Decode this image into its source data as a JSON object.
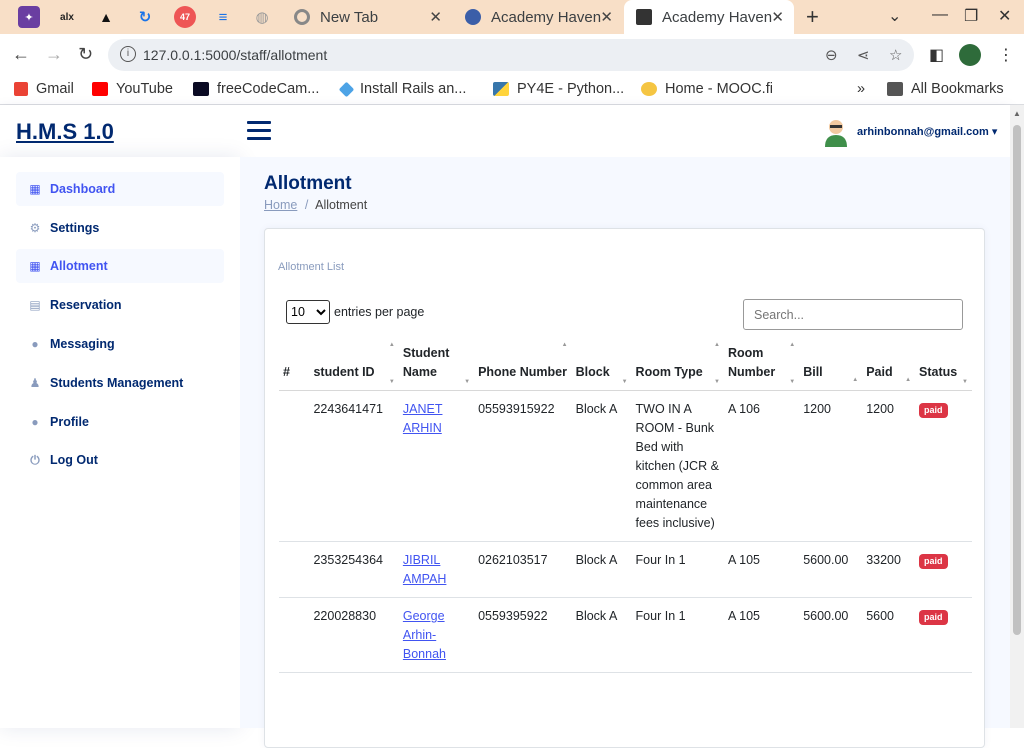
{
  "browser": {
    "tabs": [
      {
        "label": "New Tab"
      },
      {
        "label": "Academy Haven"
      },
      {
        "label": "Academy Haven"
      }
    ],
    "pinned_badge": "47",
    "pinned_alx": "alx",
    "url": "127.0.0.1:5000/staff/allotment",
    "bookmarks": [
      "Gmail",
      "YouTube",
      "freeCodeCam...",
      "Install Rails an...",
      "PY4E - Python...",
      "Home - MOOC.fi"
    ],
    "all_bookmarks": "All Bookmarks"
  },
  "app": {
    "logo": "H.M.S 1.0",
    "user_email": "arhinbonnah@gmail.com"
  },
  "sidebar": {
    "items": [
      {
        "label": "Dashboard",
        "icon": "grid-icon"
      },
      {
        "label": "Settings",
        "icon": "gear-icon"
      },
      {
        "label": "Allotment",
        "icon": "grid-icon"
      },
      {
        "label": "Reservation",
        "icon": "journal-icon"
      },
      {
        "label": "Messaging",
        "icon": "chat-icon"
      },
      {
        "label": "Students Management",
        "icon": "student-icon"
      },
      {
        "label": "Profile",
        "icon": "person-icon"
      },
      {
        "label": "Log Out",
        "icon": "logout-icon"
      }
    ]
  },
  "page": {
    "title": "Allotment",
    "breadcrumb_home": "Home",
    "breadcrumb_sep": "/",
    "breadcrumb_current": "Allotment",
    "card_title": "Allotment List",
    "per_page_value": "10",
    "per_page_label": "entries per page",
    "search_placeholder": "Search..."
  },
  "table": {
    "headers": [
      "#",
      "student ID",
      "Student Name",
      "Phone Number",
      "Block",
      "Room Type",
      "Room Number",
      "Bill",
      "Paid",
      "Status"
    ],
    "rows": [
      {
        "num": "",
        "student_id": "2243641471",
        "name": "JANET ARHIN",
        "phone": "05593915922",
        "block": "Block A",
        "room_type": "TWO IN A ROOM - Bunk Bed with kitchen (JCR & common area maintenance fees inclusive)",
        "room_number": "A 106",
        "bill": "1200",
        "paid": "1200",
        "status": "paid"
      },
      {
        "num": "",
        "student_id": "2353254364",
        "name": "JIBRIL AMPAH",
        "phone": "0262103517",
        "block": "Block A",
        "room_type": "Four In 1",
        "room_number": "A 105",
        "bill": "5600.00",
        "paid": "33200",
        "status": "paid"
      },
      {
        "num": "",
        "student_id": "220028830",
        "name": "George Arhin-Bonnah",
        "phone": "0559395922",
        "block": "Block A",
        "room_type": "Four In 1",
        "room_number": "A 105",
        "bill": "5600.00",
        "paid": "5600",
        "status": "paid"
      }
    ]
  },
  "colors": {
    "primary": "#012970",
    "accent": "#4154f1",
    "badge": "#dc3545",
    "tabbar": "#f8dfc7"
  }
}
